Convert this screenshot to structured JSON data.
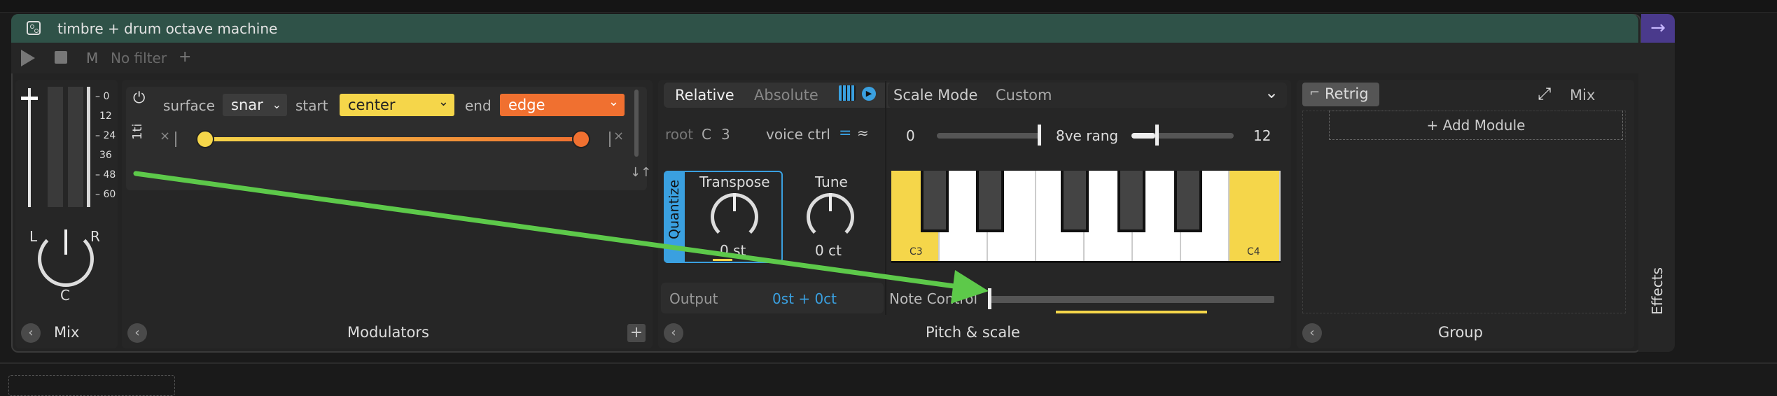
{
  "device": {
    "title": "timbre + drum octave machine",
    "effects_label": "Effects",
    "colors": {
      "title_bar": "#2f5248",
      "accent_yellow": "#f5d64a",
      "accent_orange": "#f07030",
      "accent_blue": "#3aa0e0",
      "arrow_green": "#5dc94a"
    }
  },
  "transport": {
    "mute_label": "M",
    "filter_label": "No filter",
    "add_label": "+"
  },
  "mix": {
    "footer": "Mix",
    "db_ticks": [
      "0",
      "12",
      "24",
      "36",
      "48",
      "60"
    ],
    "pan_left": "L",
    "pan_right": "R",
    "pan_center": "C",
    "fader_level": 0.95,
    "pan_value": 0.0
  },
  "modulators": {
    "footer": "Modulators",
    "rotated_label": "1ti",
    "surface_label": "surface",
    "surface_value": "snar",
    "start_label": "start",
    "start_value": "center",
    "end_label": "end",
    "end_value": "edge"
  },
  "pitch": {
    "footer": "Pitch & scale",
    "tab_relative": "Relative",
    "tab_absolute": "Absolute",
    "root_label": "root",
    "root_note": "C",
    "root_octave": "3",
    "voice_ctrl_label": "voice ctrl",
    "quantize_label": "Quantize",
    "transpose_label": "Transpose",
    "transpose_value": "0 st",
    "tune_label": "Tune",
    "tune_value": "0 ct",
    "output_label": "Output",
    "output_value": "0st + 0ct",
    "scale_mode_label": "Scale Mode",
    "scale_mode_value": "Custom",
    "range_min": "0",
    "range_label": "8ve rang",
    "range_max": "12",
    "key_low": "C3",
    "key_high": "C4",
    "note_control_label": "Note Control"
  },
  "group": {
    "footer": "Group",
    "retrig_label": "Retrig",
    "mix_label": "Mix",
    "add_module_label": "+ Add Module"
  }
}
